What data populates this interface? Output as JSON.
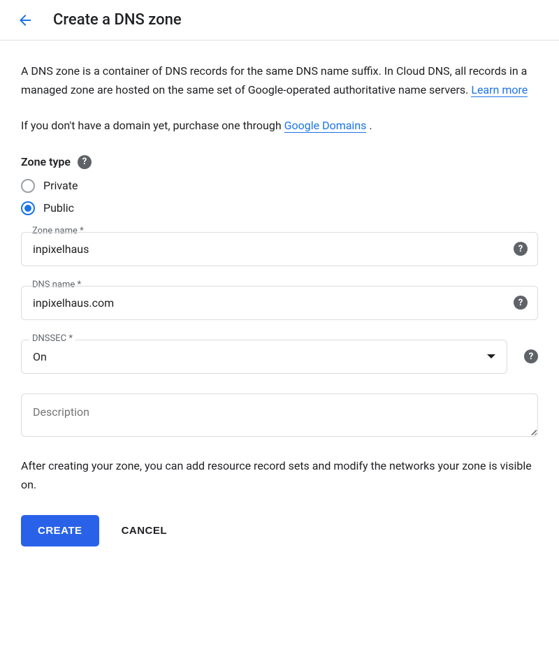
{
  "header": {
    "title": "Create a DNS zone"
  },
  "intro": {
    "text_before_link": "A DNS zone is a container of DNS records for the same DNS name suffix. In Cloud DNS, all records in a managed zone are hosted on the same set of Google-operated authoritative name servers. ",
    "link": "Learn more"
  },
  "domain_note": {
    "text_before": "If you don't have a domain yet, purchase one through ",
    "link": "Google Domains",
    "text_after": " ."
  },
  "zone_type": {
    "label": "Zone type",
    "options": {
      "private": "Private",
      "public": "Public"
    },
    "selected": "public"
  },
  "fields": {
    "zone_name": {
      "label": "Zone name *",
      "value": "inpixelhaus"
    },
    "dns_name": {
      "label": "DNS name *",
      "value": "inpixelhaus.com"
    },
    "dnssec": {
      "label": "DNSSEC *",
      "value": "On"
    },
    "description": {
      "placeholder": "Description"
    }
  },
  "after_note": "After creating your zone, you can add resource record sets and modify the networks your zone is visible on.",
  "buttons": {
    "create": "CREATE",
    "cancel": "CANCEL"
  },
  "help_glyph": "?"
}
